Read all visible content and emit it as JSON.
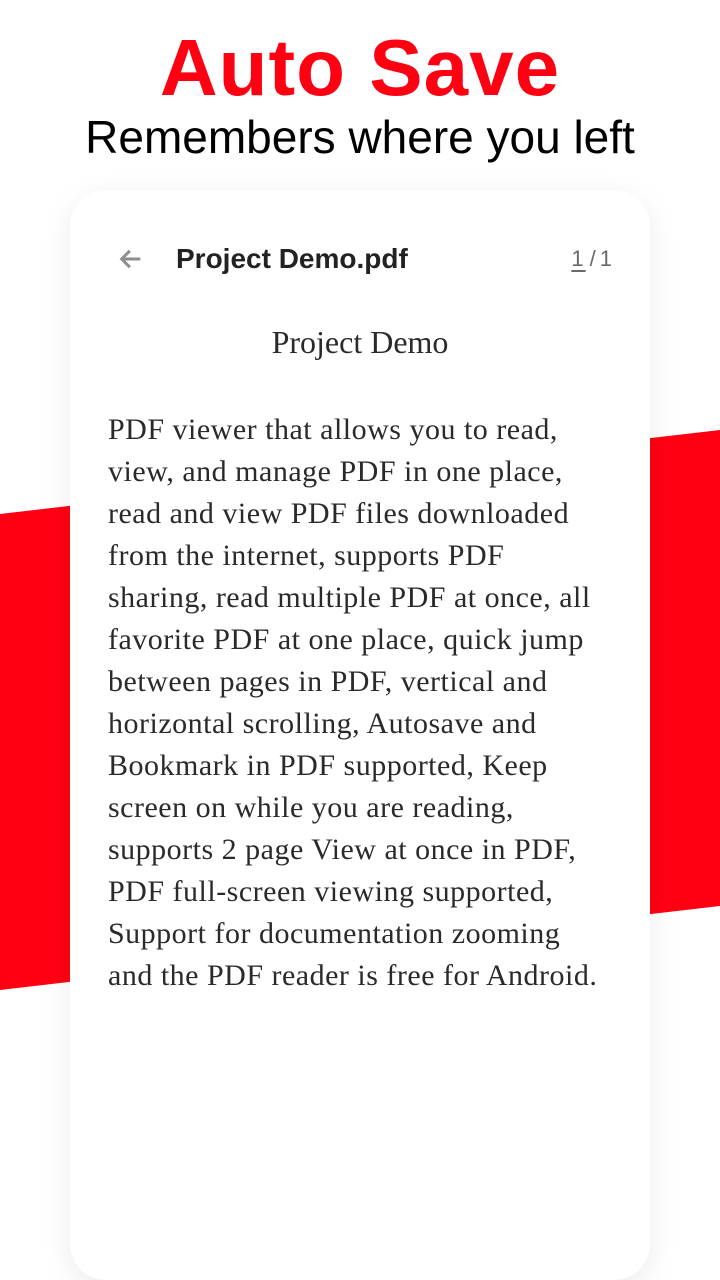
{
  "headline": {
    "title": "Auto Save",
    "subtitle": "Remembers where you left"
  },
  "viewer": {
    "file_name": "Project Demo.pdf",
    "page_current": "1",
    "page_total": "1"
  },
  "document": {
    "title": "Project Demo",
    "body": "PDF viewer that allows you to read, view, and manage PDF in one place, read and view PDF files downloaded from the internet, supports PDF sharing, read multiple PDF at once, all favorite PDF at one place, quick jump between pages in PDF, vertical and horizontal scrolling, Autosave and Bookmark in PDF supported, Keep screen on while you are reading, supports 2 page View at once in PDF, PDF full-screen viewing supported, Support for documentation zooming and the PDF reader is free for Android."
  }
}
